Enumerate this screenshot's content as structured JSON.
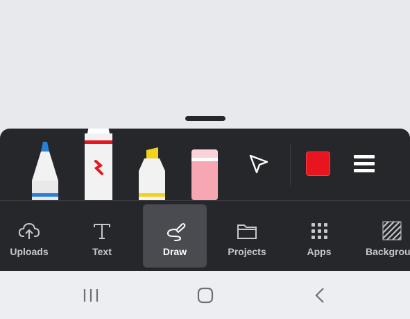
{
  "tools": {
    "pen": "pen-icon",
    "marker": "marker-icon",
    "highlighter": "highlighter-icon",
    "eraser": "eraser-icon",
    "select": "pointer-arrow-icon",
    "color": "#e8141e",
    "menu": "hamburger-icon"
  },
  "colors": {
    "tray_bg": "#26272b",
    "canvas_bg": "#e8e9ed",
    "active_tab_bg": "#4a4b50",
    "pen_accent": "#2a7fd6",
    "marker_accent": "#e8141e",
    "highlighter_accent": "#f2d21d",
    "eraser_color": "#f7a7b1"
  },
  "nav": {
    "items": [
      {
        "label": "Uploads",
        "icon": "cloud-upload-icon"
      },
      {
        "label": "Text",
        "icon": "text-icon"
      },
      {
        "label": "Draw",
        "icon": "draw-icon",
        "active": true
      },
      {
        "label": "Projects",
        "icon": "folder-icon"
      },
      {
        "label": "Apps",
        "icon": "grid-icon"
      },
      {
        "label": "Backgrou",
        "icon": "background-pattern-icon"
      }
    ]
  },
  "system_nav": {
    "recents": "recents-icon",
    "home": "home-icon",
    "back": "back-icon"
  }
}
